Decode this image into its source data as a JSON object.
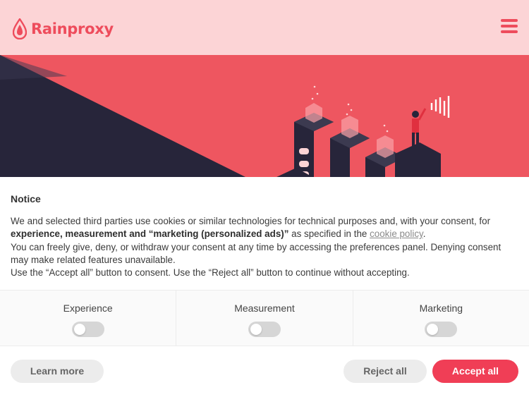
{
  "header": {
    "brand": "Rainproxy",
    "menu_icon": "hamburger-menu-icon",
    "logo_icon": "raindrop-icon"
  },
  "hero": {
    "illustration": "isometric-city-illustration"
  },
  "notice": {
    "title": "Notice",
    "line1_start": "We and selected third parties use cookies or similar technologies for technical purposes and, with your consent, for",
    "line2_bold": "experience, measurement and “marketing (personalized ads)”",
    "line2_rest": " as specified in the ",
    "cookie_policy_link": "cookie policy",
    "line2_end": ".",
    "line3": "You can freely give, deny, or withdraw your consent at any time by accessing the preferences panel. Denying consent may make related features unavailable.",
    "line4": "Use the “Accept all” button to consent. Use the “Reject all” button to continue without accepting."
  },
  "toggles": [
    {
      "label": "Experience",
      "checked": false
    },
    {
      "label": "Measurement",
      "checked": false
    },
    {
      "label": "Marketing",
      "checked": false
    }
  ],
  "buttons": {
    "learn_more": "Learn more",
    "reject_all": "Reject all",
    "accept_all": "Accept all"
  },
  "colors": {
    "brand": "#ee4c5c",
    "header_bg": "#fcd4d6",
    "hero_red": "#ee5660",
    "hero_dark": "#27253a",
    "accept_button": "#f03e56",
    "neutral_button": "#ececec"
  }
}
